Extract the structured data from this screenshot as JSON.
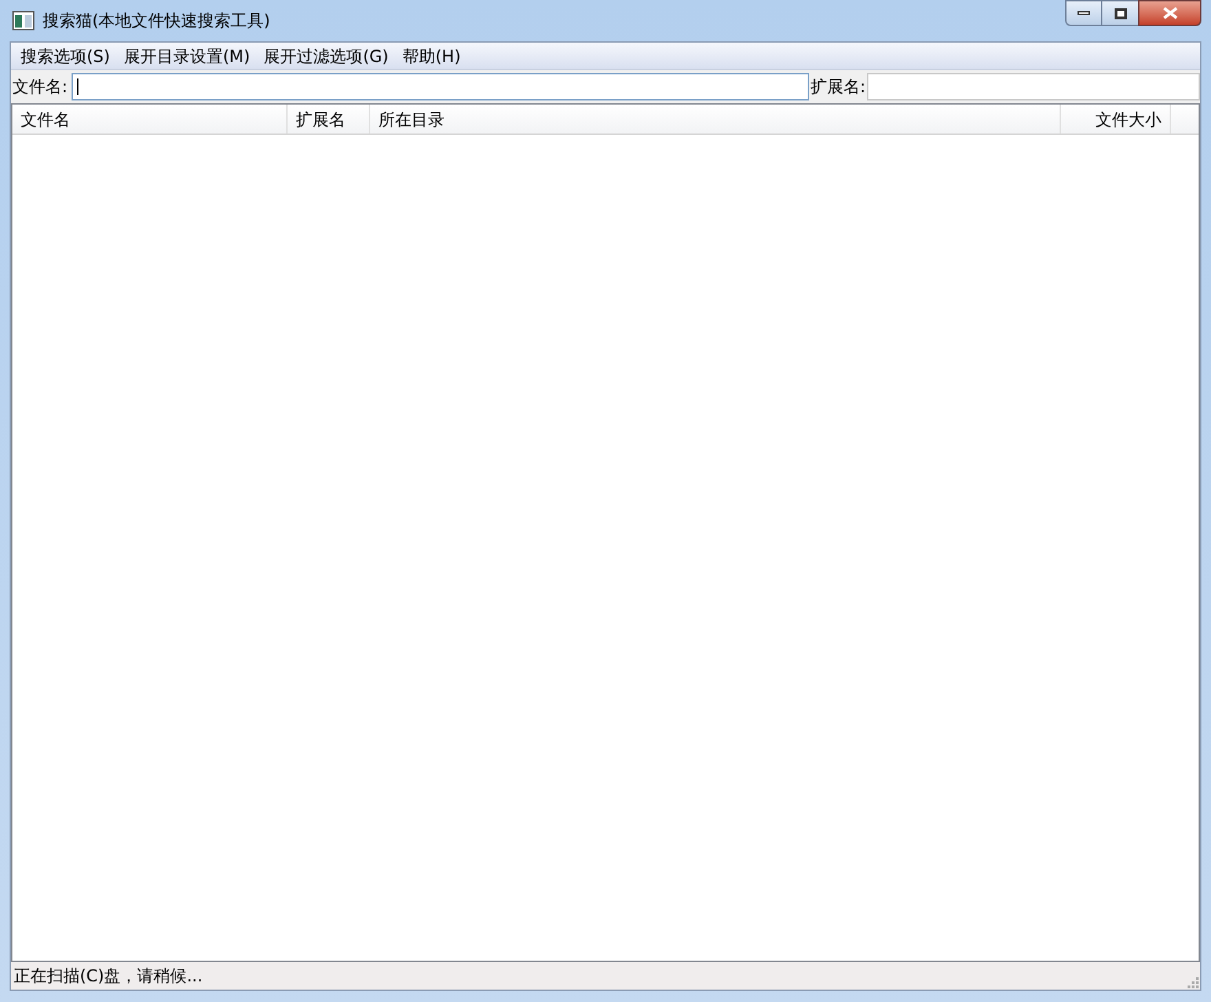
{
  "window": {
    "title": "搜索猫(本地文件快速搜索工具)"
  },
  "menu": [
    "搜索选项(S)",
    "展开目录设置(M)",
    "展开过滤选项(G)",
    "帮助(H)"
  ],
  "search": {
    "filename_label": "文件名:",
    "extension_label": "扩展名:"
  },
  "table": {
    "columns": [
      "文件名",
      "扩展名",
      "所在目录",
      "文件大小"
    ]
  },
  "status_bar": "正在扫描(C)盘，请稍候..."
}
